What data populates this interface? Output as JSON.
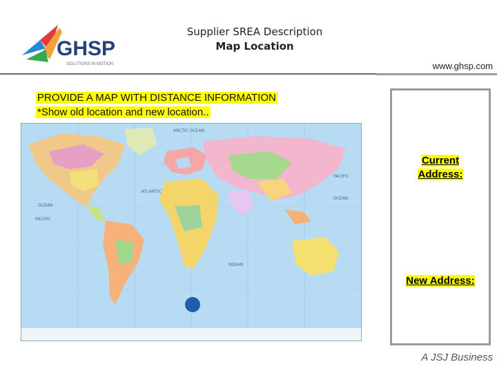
{
  "header": {
    "logo_text": "GHSP",
    "logo_tagline": "SOLUTIONS IN MOTION",
    "title_line1": "Supplier SREA Description",
    "title_line2": "Map Location",
    "url": "www.ghsp.com"
  },
  "instruction": {
    "line1": "PROVIDE A MAP WITH DISTANCE INFORMATION",
    "line2": "*Show old location and new location.."
  },
  "map": {
    "ocean_color": "#b7dbf3",
    "labels": {
      "arctic": "ARCTIC OCEAN",
      "pacific_left": "PACIFIC",
      "pacific_right": "PACIFIC",
      "atlantic": "ATLANTIC",
      "indian": "INDIAN",
      "ocean_left": "OCEAN",
      "ocean_right": "OCEAN"
    }
  },
  "address_box": {
    "current_line1": "Current",
    "current_line2": "Address:",
    "new_label": "New Address:"
  },
  "footer": {
    "text": "A JSJ Business"
  }
}
